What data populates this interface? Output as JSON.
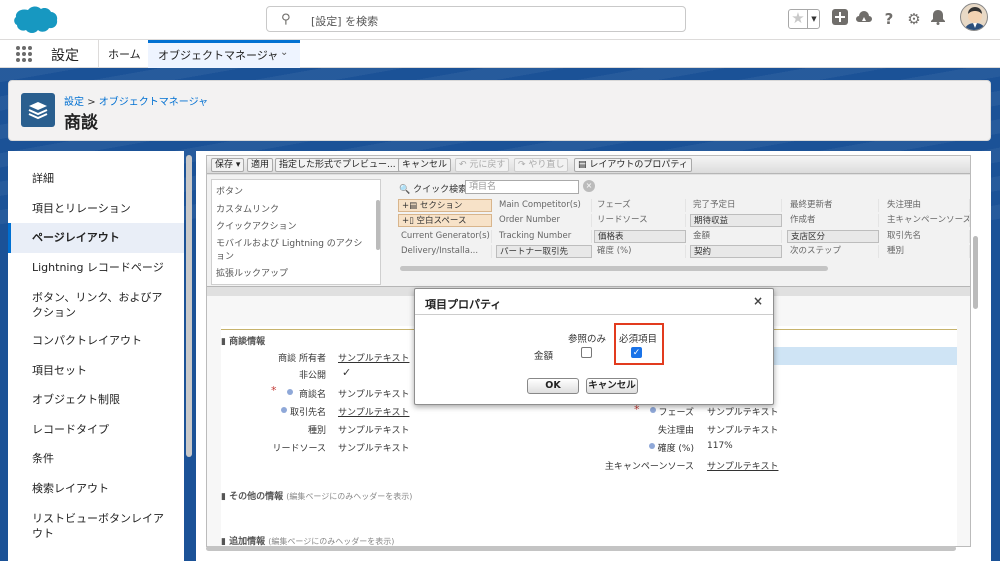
{
  "topbar": {
    "search_placeholder": "[設定] を検索",
    "icons": [
      "salesforce-cloud-logo",
      "search-icon",
      "favorite-star-icon",
      "add-icon",
      "trailhead-icon",
      "help-icon",
      "setup-gear-icon",
      "notification-bell-icon",
      "user-avatar"
    ]
  },
  "nav": {
    "app_name": "設定",
    "home": "ホーム",
    "tab": "オブジェクトマネージャ"
  },
  "header": {
    "breadcrumb_root": "設定",
    "breadcrumb_sep": ">",
    "breadcrumb_current": "オブジェクトマネージャ",
    "title": "商談"
  },
  "left_nav": {
    "items": [
      "詳細",
      "項目とリレーション",
      "ページレイアウト",
      "Lightning レコードページ",
      "ボタン、リンク、およびアクション",
      "コンパクトレイアウト",
      "項目セット",
      "オブジェクト制限",
      "レコードタイプ",
      "条件",
      "検索レイアウト",
      "リストビューボタンレイアウト"
    ],
    "selected": "ページレイアウト"
  },
  "toolbar": {
    "save": "保存 ▾",
    "quick_save": "適用",
    "preview": "指定した形式でプレビュー... ▾",
    "cancel": "キャンセル",
    "undo": "元に戻す",
    "redo": "やり直し",
    "layout_props": "レイアウトのプロパティ"
  },
  "palette": {
    "categories": [
      "ボタン",
      "カスタムリンク",
      "クイックアクション",
      "モバイルおよび Lightning のアクション",
      "拡張ルックアップ"
    ],
    "quick_find_label": "クイック検索",
    "quick_find_placeholder": "項目名",
    "fields": [
      [
        "+▤ セクション",
        "Main Competitor(s)",
        "フェーズ",
        "完了予定日",
        "最終更新者",
        "失注理由"
      ],
      [
        "+▯ 空白スペース",
        "Order Number",
        "リードソース",
        "期待収益",
        "作成者",
        "主キャンペーンソース"
      ],
      [
        "Current Generator(s)",
        "Tracking Number",
        "価格表",
        "金額",
        "支店区分",
        "取引先名"
      ],
      [
        "Delivery/Installa...",
        "パートナー取引先",
        "確度 (%)",
        "契約",
        "次のステップ",
        "種別"
      ]
    ]
  },
  "layout": {
    "section1_title": "商談情報",
    "section2_title": "その他の情報",
    "section2_note": "(編集ページにのみヘッダーを表示)",
    "section3_title": "追加情報",
    "section3_note": "(編集ページにのみヘッダーを表示)",
    "left_fields": [
      {
        "label": "商談 所有者",
        "value": "サンプルテキスト"
      },
      {
        "label": "非公開",
        "value": "✓"
      },
      {
        "label": "商談名",
        "value": "サンプルテキスト"
      },
      {
        "label": "取引先名",
        "value": "サンプルテキスト"
      },
      {
        "label": "種別",
        "value": "サンプルテキスト"
      },
      {
        "label": "リードソース",
        "value": "サンプルテキスト"
      }
    ],
    "right_fields": [
      {
        "label": "フェーズ",
        "value": "サンプルテキスト"
      },
      {
        "label": "失注理由",
        "value": "サンプルテキスト"
      },
      {
        "label": "確度 (%)",
        "value": "117%"
      },
      {
        "label": "主キャンペーンソース",
        "value": "サンプルテキスト"
      }
    ]
  },
  "modal": {
    "title": "項目プロパティ",
    "close": "×",
    "col_readonly": "参照のみ",
    "col_required": "必須項目",
    "row_label": "金額",
    "readonly_checked": false,
    "required_checked": true,
    "ok": "OK",
    "cancel": "キャンセル",
    "highlight_color": "#e23b1e"
  }
}
